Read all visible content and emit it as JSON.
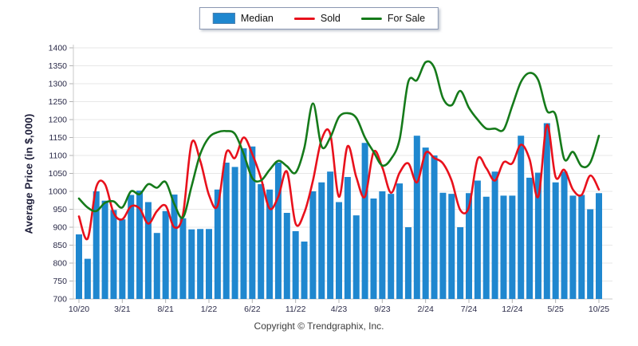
{
  "figure": {
    "y_axis_title": "Average Price (in $,000)",
    "copyright": "Copyright © Trendgraphix, Inc."
  },
  "legend": {
    "items": [
      {
        "label": "Median",
        "type": "bar",
        "color": "#1f87cf"
      },
      {
        "label": "Sold",
        "type": "line",
        "color": "#e8111c"
      },
      {
        "label": "For Sale",
        "type": "line",
        "color": "#157a1a"
      }
    ]
  },
  "chart_data": {
    "type": "bar+line combo",
    "title": "",
    "xlabel": "",
    "ylabel": "Average Price (in $,000)",
    "ylim": [
      700,
      1400
    ],
    "ytick_step": 50,
    "xtick_every": 5,
    "grid": "horizontal",
    "legend_position": "top-center",
    "categories": [
      "10/20",
      "11/20",
      "12/20",
      "1/21",
      "2/21",
      "3/21",
      "4/21",
      "5/21",
      "6/21",
      "7/21",
      "8/21",
      "9/21",
      "10/21",
      "11/21",
      "12/21",
      "1/22",
      "2/22",
      "3/22",
      "4/22",
      "5/22",
      "6/22",
      "7/22",
      "8/22",
      "9/22",
      "10/22",
      "11/22",
      "12/22",
      "1/23",
      "2/23",
      "3/23",
      "4/23",
      "5/23",
      "6/23",
      "7/23",
      "8/23",
      "9/23",
      "10/23",
      "11/23",
      "12/23",
      "1/24",
      "2/24",
      "3/24",
      "4/24",
      "5/24",
      "6/24",
      "7/24",
      "8/24",
      "9/24",
      "10/24",
      "11/24",
      "12/24",
      "1/25",
      "2/25",
      "3/25",
      "4/25",
      "5/25",
      "6/25",
      "7/25",
      "8/25",
      "9/25",
      "10/25"
    ],
    "series": [
      {
        "name": "Median",
        "type": "bar",
        "color": "#1f87cf",
        "values": [
          880,
          812,
          1000,
          974,
          948,
          922,
          990,
          1002,
          970,
          884,
          945,
          991,
          925,
          894,
          895,
          895,
          1005,
          1080,
          1068,
          1120,
          1125,
          1020,
          1005,
          1080,
          940,
          889,
          860,
          1000,
          1025,
          1055,
          970,
          1040,
          933,
          1135,
          980,
          1000,
          993,
          1022,
          900,
          1155,
          1122,
          1100,
          996,
          993,
          900,
          995,
          1030,
          985,
          1055,
          988,
          988,
          1155,
          1038,
          1052,
          1190,
          1025,
          1055,
          988,
          990,
          950,
          995
        ]
      },
      {
        "name": "Sold",
        "type": "line",
        "color": "#e8111c",
        "values": [
          930,
          868,
          1012,
          1020,
          940,
          922,
          958,
          952,
          910,
          945,
          960,
          900,
          935,
          1135,
          1085,
          990,
          960,
          1108,
          1093,
          1150,
          1104,
          1037,
          952,
          985,
          1055,
          910,
          940,
          1030,
          1145,
          1160,
          985,
          1126,
          1040,
          985,
          1110,
          1067,
          996,
          1052,
          1078,
          1025,
          1107,
          1093,
          1078,
          1030,
          948,
          956,
          1090,
          1065,
          1030,
          1081,
          1078,
          1130,
          1089,
          985,
          1185,
          1040,
          1060,
          1005,
          990,
          1044,
          1005
        ]
      },
      {
        "name": "For Sale",
        "type": "line",
        "color": "#157a1a",
        "values": [
          980,
          955,
          945,
          968,
          972,
          955,
          1000,
          992,
          1020,
          1010,
          1026,
          965,
          927,
          1015,
          1104,
          1150,
          1165,
          1168,
          1160,
          1105,
          1037,
          1030,
          1060,
          1085,
          1070,
          1052,
          1120,
          1245,
          1125,
          1150,
          1207,
          1218,
          1205,
          1150,
          1110,
          1072,
          1090,
          1145,
          1305,
          1310,
          1360,
          1345,
          1260,
          1240,
          1280,
          1233,
          1200,
          1175,
          1175,
          1172,
          1238,
          1305,
          1330,
          1310,
          1225,
          1213,
          1090,
          1110,
          1070,
          1080,
          1155
        ]
      }
    ],
    "style": {
      "grid_color": "#e7e7e7",
      "axis_color": "#c9c9c9",
      "tick_color": "#b3b3b3",
      "tick_label_color": "#2a2a48"
    }
  }
}
